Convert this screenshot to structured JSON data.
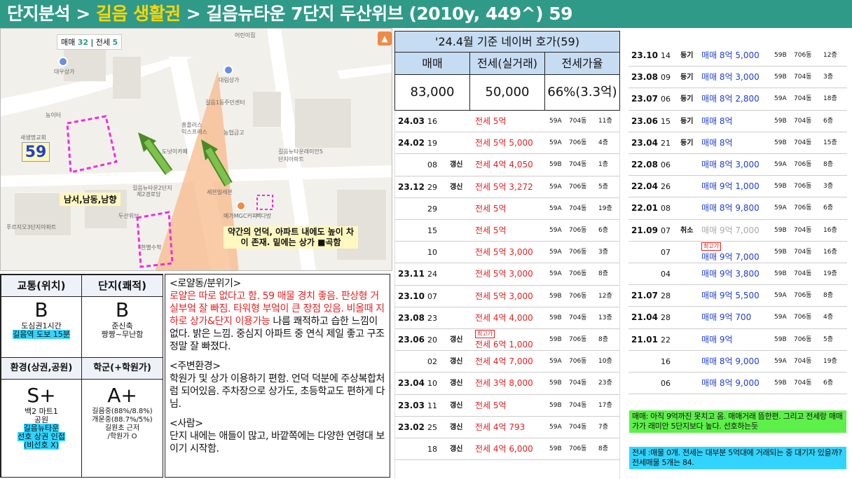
{
  "header": {
    "title_white": "단지분석 > ",
    "title_yellow": "길음 생활권",
    "title_white2": " > 길음뉴타운 7단지 두산위브 (2010y, 449^) 59"
  },
  "map": {
    "counts": {
      "sale_label": "매매",
      "sale_count": "32",
      "jeonse_label": "전세",
      "jeonse_count": "5"
    },
    "unit_label": "59",
    "orientation": "남서,남동,남향",
    "annotation": "약간의 언덕, 아파트 내에도 높이 차\n이 존재. 밑에는 상가 ■곡함",
    "place_labels": [
      "대우상가",
      "대림상가",
      "농협금고",
      "흥플러스",
      "익스프레스",
      "길음1동주민센터",
      "새생명교회",
      "농이터",
      "길음뉴타운2단지",
      "제2경로당",
      "세븐일레븐",
      "메가MGC커피",
      "빽다방",
      "두산위브",
      "푸르지오3단지아파트",
      "한별수학",
      "길음뉴타운래미안5단지아파트",
      "어린이집",
      "도넛이카페"
    ]
  },
  "summary_table": {
    "h_transport": "교통(위치)",
    "h_complex": "단지(쾌적)",
    "g_transport": "B",
    "d_transport": "도심권1시간",
    "hl_transport": "길음역 도보 15분",
    "g_complex": "B",
    "d_complex1": "준신축",
    "d_complex2": "짱짱~무난함",
    "h_env": "환경(상권,공원)",
    "h_school": "학군(+학원가)",
    "g_env": "S+",
    "d_env1": "백2 마트1",
    "d_env2": "공원",
    "hl_env1": "길음뉴타운",
    "hl_env2": "선호 상권 인접",
    "hl_env3": "(비선호 X)",
    "g_school": "A+",
    "d_school1": "길음중(88%/8.8%)",
    "d_school2": "개운중(88.7%/5%)",
    "d_school3": "길원초 근저",
    "d_school4": "/학원가 O"
  },
  "notes": {
    "h1": "<로얄동/분위기>",
    "p1_red": "로얄은 따로 없다고 함. 59 매물 경치 좋음. 판상형 거실부엌 잘 빠짐. 타워형 부엌이 큰 장점 있음. 비올때 지하로 상가&단지 이용가능",
    "p1_black": " 나름 쾌적하고 습한 느낌이 없다. 밝은 느낌. 중심지 아파트 중 연식 제일 좋고 구조 정말 잘 빠졌다.",
    "h2": "<주변환경>",
    "p2": " 학원가 및 상가 이용하기 편함. 언덕 덕분에 주상복합처럼 되어있음. 주차장으로 상가도, 초등학교도 편하게 다님.",
    "h3": "<사람>",
    "p3": "단지 내에는 애들이 많고, 바깥쪽에는 다양한 연령대 보이기 시작함."
  },
  "price_header": {
    "title": "'24.4월 기준 네이버 호가(59)",
    "cols": [
      "매매",
      "전세(실거래)",
      "전세가율"
    ],
    "vals": [
      "83,000",
      "50,000",
      "66%(3.3억)"
    ]
  },
  "list_mid": [
    {
      "d": "24.03",
      "day": "16",
      "k": "",
      "p": "전세 5억",
      "tp": "59A",
      "dong": "704동",
      "fl": "11층",
      "c": "red"
    },
    {
      "d": "24.02",
      "day": "19",
      "k": "",
      "p": "전세 5억 5,000",
      "tp": "59A",
      "dong": "706동",
      "fl": "4층",
      "c": "red"
    },
    {
      "d": "",
      "day": "08",
      "k": "갱신",
      "p": "전세 4억 4,050",
      "tp": "59B",
      "dong": "704동",
      "fl": "1층",
      "c": "red"
    },
    {
      "d": "23.12",
      "day": "29",
      "k": "갱신",
      "p": "전세 5억 3,272",
      "tp": "59A",
      "dong": "706동",
      "fl": "5층",
      "c": "red"
    },
    {
      "d": "",
      "day": "29",
      "k": "",
      "p": "전세 5억",
      "tp": "59A",
      "dong": "704동",
      "fl": "19층",
      "c": "red"
    },
    {
      "d": "",
      "day": "15",
      "k": "",
      "p": "전세 5억",
      "tp": "59A",
      "dong": "706동",
      "fl": "6층",
      "c": "red"
    },
    {
      "d": "",
      "day": "10",
      "k": "",
      "p": "전세 5억 3,000",
      "tp": "59A",
      "dong": "706동",
      "fl": "3층",
      "c": "red"
    },
    {
      "d": "23.11",
      "day": "24",
      "k": "",
      "p": "전세 5억 3,000",
      "tp": "59A",
      "dong": "706동",
      "fl": "8층",
      "c": "red"
    },
    {
      "d": "23.10",
      "day": "07",
      "k": "",
      "p": "전세 5억 3,000",
      "tp": "59B",
      "dong": "706동",
      "fl": "12층",
      "c": "red"
    },
    {
      "d": "23.08",
      "day": "23",
      "k": "",
      "p": "전세 4억 4,000",
      "tp": "59B",
      "dong": "704동",
      "fl": "13층",
      "c": "red"
    },
    {
      "d": "23.06",
      "day": "20",
      "k": "갱신",
      "p": "전세 6억 1,000",
      "tp": "59B",
      "dong": "706동",
      "fl": "8층",
      "c": "red",
      "tag": "최고가"
    },
    {
      "d": "",
      "day": "02",
      "k": "갱신",
      "p": "전세 4억 7,000",
      "tp": "59A",
      "dong": "706동",
      "fl": "10층",
      "c": "red"
    },
    {
      "d": "23.04",
      "day": "10",
      "k": "갱신",
      "p": "전세 3억 8,000",
      "tp": "59B",
      "dong": "704동",
      "fl": "23층",
      "c": "red"
    },
    {
      "d": "23.03",
      "day": "11",
      "k": "갱신",
      "p": "전세 5억",
      "tp": "59B",
      "dong": "704동",
      "fl": "17층",
      "c": "red"
    },
    {
      "d": "23.02",
      "day": "25",
      "k": "갱신",
      "p": "전세 4억 793",
      "tp": "59A",
      "dong": "704동",
      "fl": "7층",
      "c": "red"
    },
    {
      "d": "",
      "day": "18",
      "k": "갱신",
      "p": "전세 4억 6,000",
      "tp": "59B",
      "dong": "706동",
      "fl": "8층",
      "c": "red"
    }
  ],
  "list_right": [
    {
      "d": "23.10",
      "day": "14",
      "k": "등기",
      "p": "매매 8억 5,000",
      "tp": "59B",
      "dong": "706동",
      "fl": "12층"
    },
    {
      "d": "23.08",
      "day": "09",
      "k": "등기",
      "p": "매매 8억 3,000",
      "tp": "59B",
      "dong": "704동",
      "fl": "3층"
    },
    {
      "d": "23.07",
      "day": "06",
      "k": "등기",
      "p": "매매 8억 2,800",
      "tp": "59A",
      "dong": "704동",
      "fl": "18층"
    },
    {
      "d": "23.06",
      "day": "15",
      "k": "등기",
      "p": "매매 8억",
      "tp": "59B",
      "dong": "704동",
      "fl": "6층"
    },
    {
      "d": "23.04",
      "day": "21",
      "k": "등기",
      "p": "매매 8억",
      "tp": "59B",
      "dong": "704동",
      "fl": "15층"
    },
    {
      "d": "22.08",
      "day": "06",
      "k": "",
      "p": "매매 8억 3,000",
      "tp": "59A",
      "dong": "706동",
      "fl": "8층"
    },
    {
      "d": "22.04",
      "day": "26",
      "k": "",
      "p": "매매 9억 1,000",
      "tp": "59B",
      "dong": "706동",
      "fl": "3층"
    },
    {
      "d": "22.01",
      "day": "08",
      "k": "",
      "p": "매매 8억 9,800",
      "tp": "59A",
      "dong": "706동",
      "fl": "6층"
    },
    {
      "d": "21.09",
      "day": "07",
      "k": "취소",
      "p": "매매 9억 7,000",
      "tp": "59B",
      "dong": "704동",
      "fl": "16층",
      "gray": true
    },
    {
      "d": "",
      "day": "07",
      "k": "",
      "p": "매매 9억 7,000",
      "tp": "59B",
      "dong": "704동",
      "fl": "16층",
      "tag": "최고가"
    },
    {
      "d": "",
      "day": "04",
      "k": "",
      "p": "매매 9억 3,800",
      "tp": "59B",
      "dong": "704동",
      "fl": "19층"
    },
    {
      "d": "21.07",
      "day": "28",
      "k": "",
      "p": "매매 9억 5,500",
      "tp": "59A",
      "dong": "706동",
      "fl": "8층"
    },
    {
      "d": "21.04",
      "day": "28",
      "k": "",
      "p": "매매 9억 700",
      "tp": "59A",
      "dong": "706동",
      "fl": "4층"
    },
    {
      "d": "21.01",
      "day": "22",
      "k": "",
      "p": "매매 9억",
      "tp": "59B",
      "dong": "706동",
      "fl": "5층"
    },
    {
      "d": "",
      "day": "16",
      "k": "",
      "p": "매매 8억 9,000",
      "tp": "59A",
      "dong": "704동",
      "fl": "19층"
    },
    {
      "d": "",
      "day": "06",
      "k": "",
      "p": "매매 8억 9,000",
      "tp": "59B",
      "dong": "704동",
      "fl": "6층"
    }
  ],
  "bottom_notes": {
    "green": "매매: 아직 9억까진 못치고 옴. 매매거래 뜸한편. 그리고 전세랑 매매가가 래미안 5단지보다 높다. 선호하는듯",
    "cyan": "전세 :매물 0개. 전세는 대부분 5억대에 거래되는 중 대기자 있을까? 전세매물 5개는 84."
  },
  "colors": {
    "header_bg": "#2f9a88",
    "accent_yellow": "#ffd600",
    "price_red": "#e32222",
    "price_blue": "#1f3fd0",
    "highlight_cyan": "#31d4ff",
    "highlight_green": "#5ef04a",
    "table_header": "#c6dcf3"
  }
}
